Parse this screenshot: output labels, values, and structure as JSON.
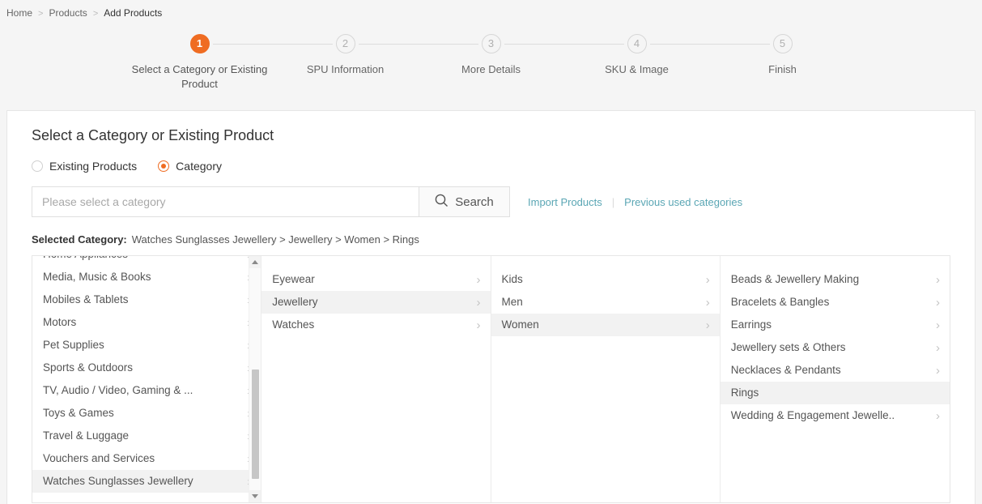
{
  "breadcrumb": {
    "items": [
      {
        "label": "Home",
        "current": false
      },
      {
        "label": "Products",
        "current": false
      },
      {
        "label": "Add Products",
        "current": true
      }
    ],
    "separator": ">"
  },
  "stepper": {
    "steps": [
      {
        "num": "1",
        "label": "Select a Category or Existing Product",
        "active": true
      },
      {
        "num": "2",
        "label": "SPU Information",
        "active": false
      },
      {
        "num": "3",
        "label": "More Details",
        "active": false
      },
      {
        "num": "4",
        "label": "SKU & Image",
        "active": false
      },
      {
        "num": "5",
        "label": "Finish",
        "active": false
      }
    ],
    "active_color": "#ef6c22"
  },
  "form": {
    "title": "Select a Category or Existing Product",
    "radios": [
      {
        "label": "Existing Products",
        "checked": false
      },
      {
        "label": "Category",
        "checked": true
      }
    ],
    "search": {
      "placeholder": "Please select a category",
      "value": "",
      "button_label": "Search",
      "icon": "search-icon"
    },
    "links": [
      {
        "label": "Import Products"
      },
      {
        "label": "Previous used categories"
      }
    ],
    "link_divider": "|",
    "link_color": "#5aa6b4",
    "selected_category": {
      "label": "Selected Category:",
      "path": "Watches Sunglasses Jewellery > Jewellery > Women > Rings"
    }
  },
  "category_browser": {
    "columns": [
      {
        "scrollable": true,
        "items": [
          {
            "label": "Home Appliances",
            "chevron": true,
            "selected": false
          },
          {
            "label": "Media, Music & Books",
            "chevron": true,
            "selected": false
          },
          {
            "label": "Mobiles & Tablets",
            "chevron": true,
            "selected": false
          },
          {
            "label": "Motors",
            "chevron": true,
            "selected": false
          },
          {
            "label": "Pet Supplies",
            "chevron": true,
            "selected": false
          },
          {
            "label": "Sports & Outdoors",
            "chevron": true,
            "selected": false
          },
          {
            "label": "TV, Audio / Video, Gaming & ...",
            "chevron": true,
            "selected": false
          },
          {
            "label": "Toys & Games",
            "chevron": true,
            "selected": false
          },
          {
            "label": "Travel & Luggage",
            "chevron": true,
            "selected": false
          },
          {
            "label": "Vouchers and Services",
            "chevron": true,
            "selected": false
          },
          {
            "label": "Watches Sunglasses Jewellery",
            "chevron": true,
            "selected": true
          }
        ]
      },
      {
        "scrollable": false,
        "items": [
          {
            "label": "Eyewear",
            "chevron": true,
            "selected": false
          },
          {
            "label": "Jewellery",
            "chevron": true,
            "selected": true
          },
          {
            "label": "Watches",
            "chevron": true,
            "selected": false
          }
        ]
      },
      {
        "scrollable": false,
        "items": [
          {
            "label": "Kids",
            "chevron": true,
            "selected": false
          },
          {
            "label": "Men",
            "chevron": true,
            "selected": false
          },
          {
            "label": "Women",
            "chevron": true,
            "selected": true
          }
        ]
      },
      {
        "scrollable": false,
        "items": [
          {
            "label": "Beads & Jewellery Making",
            "chevron": true,
            "selected": false
          },
          {
            "label": "Bracelets & Bangles",
            "chevron": true,
            "selected": false
          },
          {
            "label": "Earrings",
            "chevron": true,
            "selected": false
          },
          {
            "label": "Jewellery sets & Others",
            "chevron": true,
            "selected": false
          },
          {
            "label": "Necklaces & Pendants",
            "chevron": true,
            "selected": false
          },
          {
            "label": "Rings",
            "chevron": false,
            "selected": true
          },
          {
            "label": "Wedding & Engagement Jewelle..",
            "chevron": true,
            "selected": false
          }
        ]
      }
    ],
    "chevron_glyph": "›",
    "scrollbar": {
      "up_arrow": "up-arrow-icon",
      "down_arrow": "down-arrow-icon"
    }
  }
}
